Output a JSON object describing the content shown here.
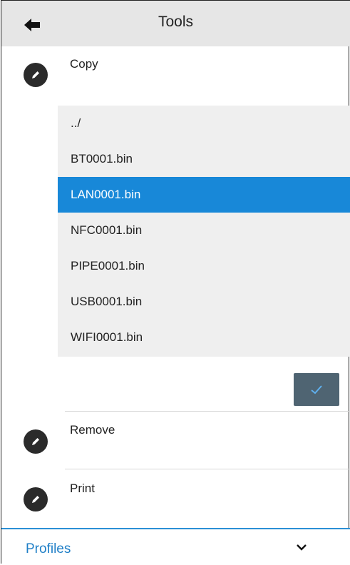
{
  "header": {
    "title": "Tools",
    "back_icon": "back-arrow-icon"
  },
  "tools": {
    "copy": {
      "label": "Copy",
      "icon": "pencil-icon"
    },
    "remove": {
      "label": "Remove",
      "icon": "pencil-icon"
    },
    "print": {
      "label": "Print",
      "icon": "pencil-icon"
    }
  },
  "file_list": {
    "items": [
      "../",
      "BT0001.bin",
      "LAN0001.bin",
      "NFC0001.bin",
      "PIPE0001.bin",
      "USB0001.bin",
      "WIFI0001.bin"
    ],
    "selected": "LAN0001.bin"
  },
  "confirm": {
    "icon": "checkmark-icon"
  },
  "footer": {
    "label": "Profiles",
    "icon": "chevron-down-icon"
  },
  "colors": {
    "header_bg": "#e6e6e6",
    "selection": "#1888d8",
    "confirm_bg": "#4f6472",
    "accent": "#1f7fc7"
  }
}
